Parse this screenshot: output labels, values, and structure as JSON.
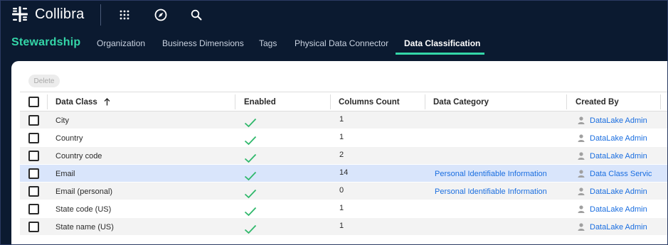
{
  "app": {
    "name": "Collibra",
    "icons": [
      "apps-grid-icon",
      "compass-icon",
      "search-icon"
    ]
  },
  "nav": {
    "brand": "Stewardship",
    "tabs": [
      {
        "label": "Organization",
        "active": false
      },
      {
        "label": "Business Dimensions",
        "active": false
      },
      {
        "label": "Tags",
        "active": false
      },
      {
        "label": "Physical Data Connector",
        "active": false
      },
      {
        "label": "Data Classification",
        "active": true
      }
    ]
  },
  "toolbar": {
    "delete_label": "Delete"
  },
  "table": {
    "columns": [
      {
        "label": "Data Class",
        "sort": "ascending"
      },
      {
        "label": "Enabled"
      },
      {
        "label": "Columns Count"
      },
      {
        "label": "Data Category"
      },
      {
        "label": "Created By"
      }
    ],
    "rows": [
      {
        "data_class": "City",
        "enabled": true,
        "columns_count": "1",
        "data_category": "",
        "created_by": "DataLake Admin",
        "selected": false
      },
      {
        "data_class": "Country",
        "enabled": true,
        "columns_count": "1",
        "data_category": "",
        "created_by": "DataLake Admin",
        "selected": false
      },
      {
        "data_class": "Country code",
        "enabled": true,
        "columns_count": "2",
        "data_category": "",
        "created_by": "DataLake Admin",
        "selected": false
      },
      {
        "data_class": "Email",
        "enabled": true,
        "columns_count": "14",
        "data_category": "Personal Identifiable Information",
        "created_by": "Data Class Servic",
        "selected": true
      },
      {
        "data_class": "Email (personal)",
        "enabled": true,
        "columns_count": "0",
        "data_category": "Personal Identifiable Information",
        "created_by": "DataLake Admin",
        "selected": false
      },
      {
        "data_class": "State code (US)",
        "enabled": true,
        "columns_count": "1",
        "data_category": "",
        "created_by": "DataLake Admin",
        "selected": false
      },
      {
        "data_class": "State name (US)",
        "enabled": true,
        "columns_count": "1",
        "data_category": "",
        "created_by": "DataLake Admin",
        "selected": false
      }
    ]
  },
  "colors": {
    "topbar_bg": "#0b1a30",
    "accent": "#34d6a8",
    "link": "#1a6ee0",
    "selected_row": "#d9e5fb",
    "alt_row": "#f3f3f3",
    "check": "#2fb86b"
  }
}
